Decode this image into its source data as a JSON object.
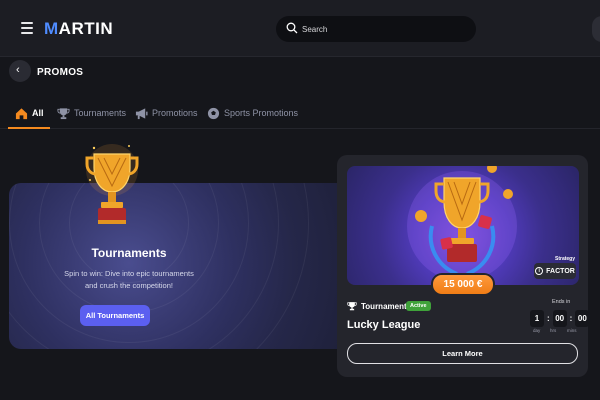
{
  "header": {
    "logo_prefix": "M",
    "logo_rest": "ARTIN",
    "search_placeholder": "Search",
    "menu_icon": "hamburger-menu-icon",
    "search_icon": "search-icon"
  },
  "page": {
    "title": "PROMOS",
    "back_icon": "chevron-left-icon"
  },
  "tabs": [
    {
      "label": "All",
      "icon": "home-icon",
      "active": true
    },
    {
      "label": "Tournaments",
      "icon": "trophy-icon",
      "active": false
    },
    {
      "label": "Promotions",
      "icon": "megaphone-icon",
      "active": false
    },
    {
      "label": "Sports Promotions",
      "icon": "soccer-ball-icon",
      "active": false
    }
  ],
  "banner": {
    "title": "Tournaments",
    "description_line1": "Spin to win: Dive into epic tournaments",
    "description_line2": "and crush the competition!",
    "button_label": "All Tournaments"
  },
  "tournament_card": {
    "prize": "15 000 €",
    "provider_tag": "Strategy",
    "provider_name": "FACTOR",
    "type_label": "Tournament",
    "status": "Active",
    "name": "Lucky League",
    "ends_label": "Ends in",
    "timer": {
      "days": "1",
      "hours": "00",
      "minutes": "00"
    },
    "timer_labels": {
      "days": "day",
      "hours": "hrs",
      "minutes": "mins"
    },
    "button_label": "Learn More"
  },
  "colors": {
    "accent": "#f58a1f",
    "primary_button": "#5b5ff0",
    "status_active": "#3fa23a",
    "logo_blue": "#4f8cff"
  }
}
